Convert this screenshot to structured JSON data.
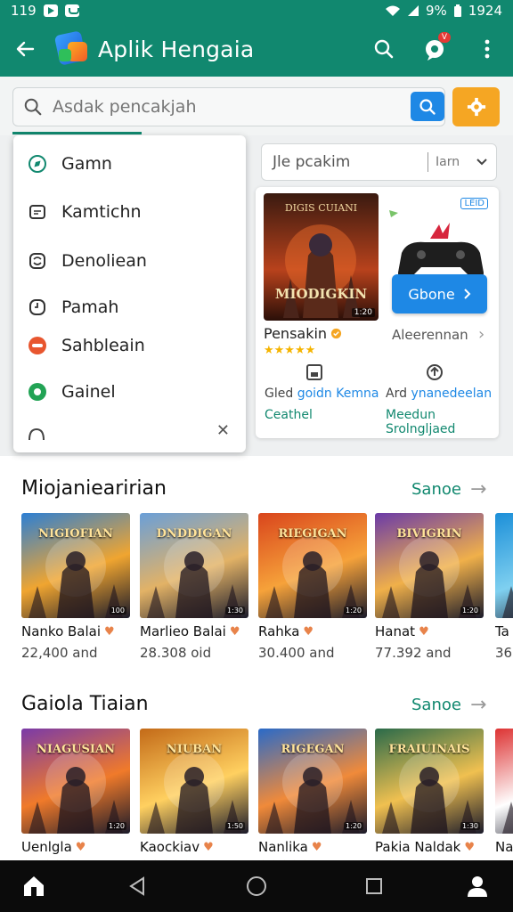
{
  "status_bar": {
    "time": "119",
    "battery": "9%",
    "clock": "1924"
  },
  "app_bar": {
    "title": "Aplik Hengaia",
    "badge": "V"
  },
  "search": {
    "placeholder": "Asdak pencakjah",
    "value": ""
  },
  "menu": {
    "items": [
      {
        "label": "Gamn",
        "icon": "compass-icon"
      },
      {
        "label": "Kamtichn",
        "icon": "document-icon"
      },
      {
        "label": "Denoliean",
        "icon": "refresh-icon"
      },
      {
        "label": "Pamah",
        "icon": "clock-icon"
      },
      {
        "label": "Sahbleain",
        "icon": "pill-icon"
      },
      {
        "label": "Gainel",
        "icon": "badge-icon"
      }
    ]
  },
  "sort": {
    "label": "Jle pcakim",
    "value": "Iarn"
  },
  "featured": {
    "title": "Pensakin",
    "image_title": "MIODIGKIN",
    "image_top": "DIGIS CUIANI",
    "duration": "1:20",
    "corner_tag": "LEID",
    "button": "Gbone",
    "alt_label": "Aleerennan",
    "rating": 5,
    "info1_a": "Gled",
    "info1_b": "goidn Kemna",
    "info1_c": "Ceathel",
    "info2_a": "Ard",
    "info2_b": "ynanedeelan",
    "info2_c": "Meedun Srolngljaed"
  },
  "sections": [
    {
      "title": "Miojaniearirian",
      "more": "Sanoe",
      "items": [
        {
          "name": "Nanko Balai",
          "count": "22,400 and",
          "art": "NIGIOFIAN",
          "tag": "100",
          "colors": [
            "#2c7fd4",
            "#f0a530"
          ]
        },
        {
          "name": "Marlieo Balai",
          "count": "28.308 oid",
          "art": "DNDDIGAN",
          "tag": "1:30",
          "colors": [
            "#6a9fd8",
            "#e2b266"
          ]
        },
        {
          "name": "Rahka",
          "count": "30.400 and",
          "art": "RIEGIGAN",
          "tag": "1:20",
          "colors": [
            "#d9451c",
            "#f6a23a"
          ]
        },
        {
          "name": "Hanat",
          "count": "77.392 and",
          "art": "BIVIGRIN",
          "tag": "1:20",
          "colors": [
            "#6a3aa8",
            "#f0b04a"
          ]
        },
        {
          "name": "Ta",
          "count": "36",
          "art": "",
          "tag": "",
          "colors": [
            "#1c8fd8",
            "#7fd0f0"
          ]
        }
      ]
    },
    {
      "title": "Gaiola Tiaian",
      "more": "Sanoe",
      "items": [
        {
          "name": "Uenlgla",
          "count": "",
          "art": "NIAGUSIAN",
          "tag": "1:20",
          "colors": [
            "#7a3aa8",
            "#f07a2a"
          ]
        },
        {
          "name": "Kaockiav",
          "count": "",
          "art": "NIUBAN",
          "tag": "1:50",
          "colors": [
            "#c36a18",
            "#ffd060"
          ]
        },
        {
          "name": "Nanlika",
          "count": "",
          "art": "RIGEGAN",
          "tag": "1:20",
          "colors": [
            "#2a6ac8",
            "#f08a3a"
          ]
        },
        {
          "name": "Pakia Naldak",
          "count": "",
          "art": "FRAIUINAIS",
          "tag": "1:30",
          "colors": [
            "#2a6a4a",
            "#f0c050"
          ]
        },
        {
          "name": "Na",
          "count": "",
          "art": "",
          "tag": "",
          "colors": [
            "#d33",
            "#ffffff"
          ]
        }
      ]
    }
  ]
}
